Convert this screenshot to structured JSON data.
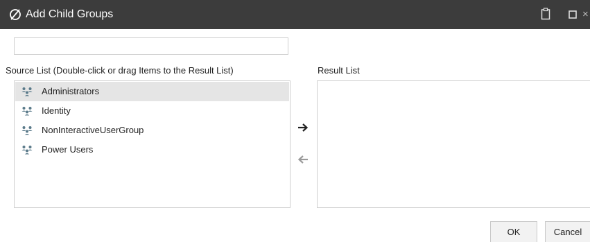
{
  "dialog": {
    "title": "Add Child Groups",
    "title_icon": "slashed-circle-icon",
    "controls": [
      "clipboard-icon",
      "maximize-icon",
      "close-icon"
    ],
    "close_glyph": "×"
  },
  "filter": {
    "value": "",
    "placeholder": ""
  },
  "source": {
    "label": "Source List (Double-click or drag Items to the Result List)",
    "items": [
      {
        "label": "Administrators",
        "icon": "group-icon",
        "selected": true
      },
      {
        "label": "Identity",
        "icon": "group-icon",
        "selected": false
      },
      {
        "label": "NonInteractiveUserGroup",
        "icon": "group-icon",
        "selected": false
      },
      {
        "label": "Power Users",
        "icon": "group-icon",
        "selected": false
      }
    ]
  },
  "transfer": {
    "add_icon": "arrow-right-icon",
    "remove_icon": "arrow-left-icon"
  },
  "result": {
    "label": "Result List",
    "items": []
  },
  "buttons": {
    "ok": "OK",
    "cancel": "Cancel"
  },
  "colors": {
    "titlebar": "#3c3c3c",
    "selected_row": "#e5e5e5",
    "group_icon": "#5a7a8a",
    "arrow_active": "#222222",
    "arrow_disabled": "#9a9a9a"
  }
}
